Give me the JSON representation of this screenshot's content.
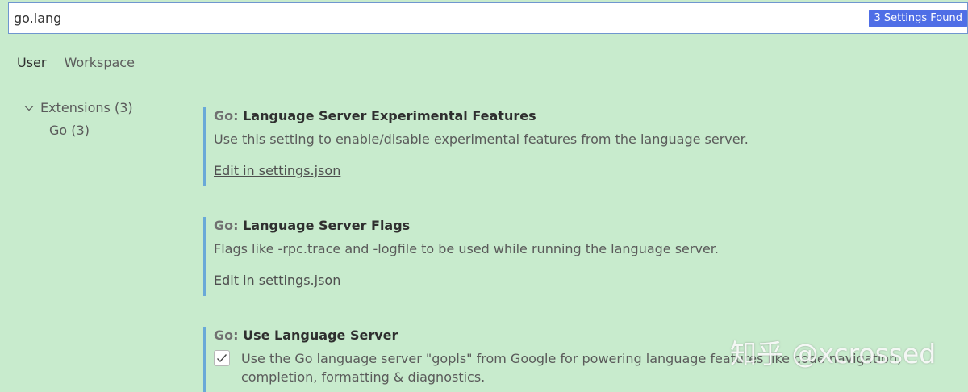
{
  "search": {
    "value": "go.lang",
    "results_badge": "3 Settings Found"
  },
  "tabs": [
    {
      "label": "User",
      "active": true
    },
    {
      "label": "Workspace",
      "active": false
    }
  ],
  "tree": {
    "group_label": "Extensions (3)",
    "child_label": "Go (3)"
  },
  "settings": [
    {
      "category": "Go:",
      "title": "Language Server Experimental Features",
      "description": "Use this setting to enable/disable experimental features from the language server.",
      "link": "Edit in settings.json"
    },
    {
      "category": "Go:",
      "title": "Language Server Flags",
      "description": "Flags like -rpc.trace and -logfile to be used while running the language server.",
      "link": "Edit in settings.json"
    },
    {
      "category": "Go:",
      "title": "Use Language Server",
      "description": "Use the Go language server \"gopls\" from Google for powering language features like code navigation, completion, formatting & diagnostics.",
      "checked": true
    }
  ],
  "watermark": "知乎 @xcrossed",
  "colors": {
    "background": "#c8ebcd",
    "badge": "#4f6ee6",
    "setting_border": "#6aa9d8"
  }
}
